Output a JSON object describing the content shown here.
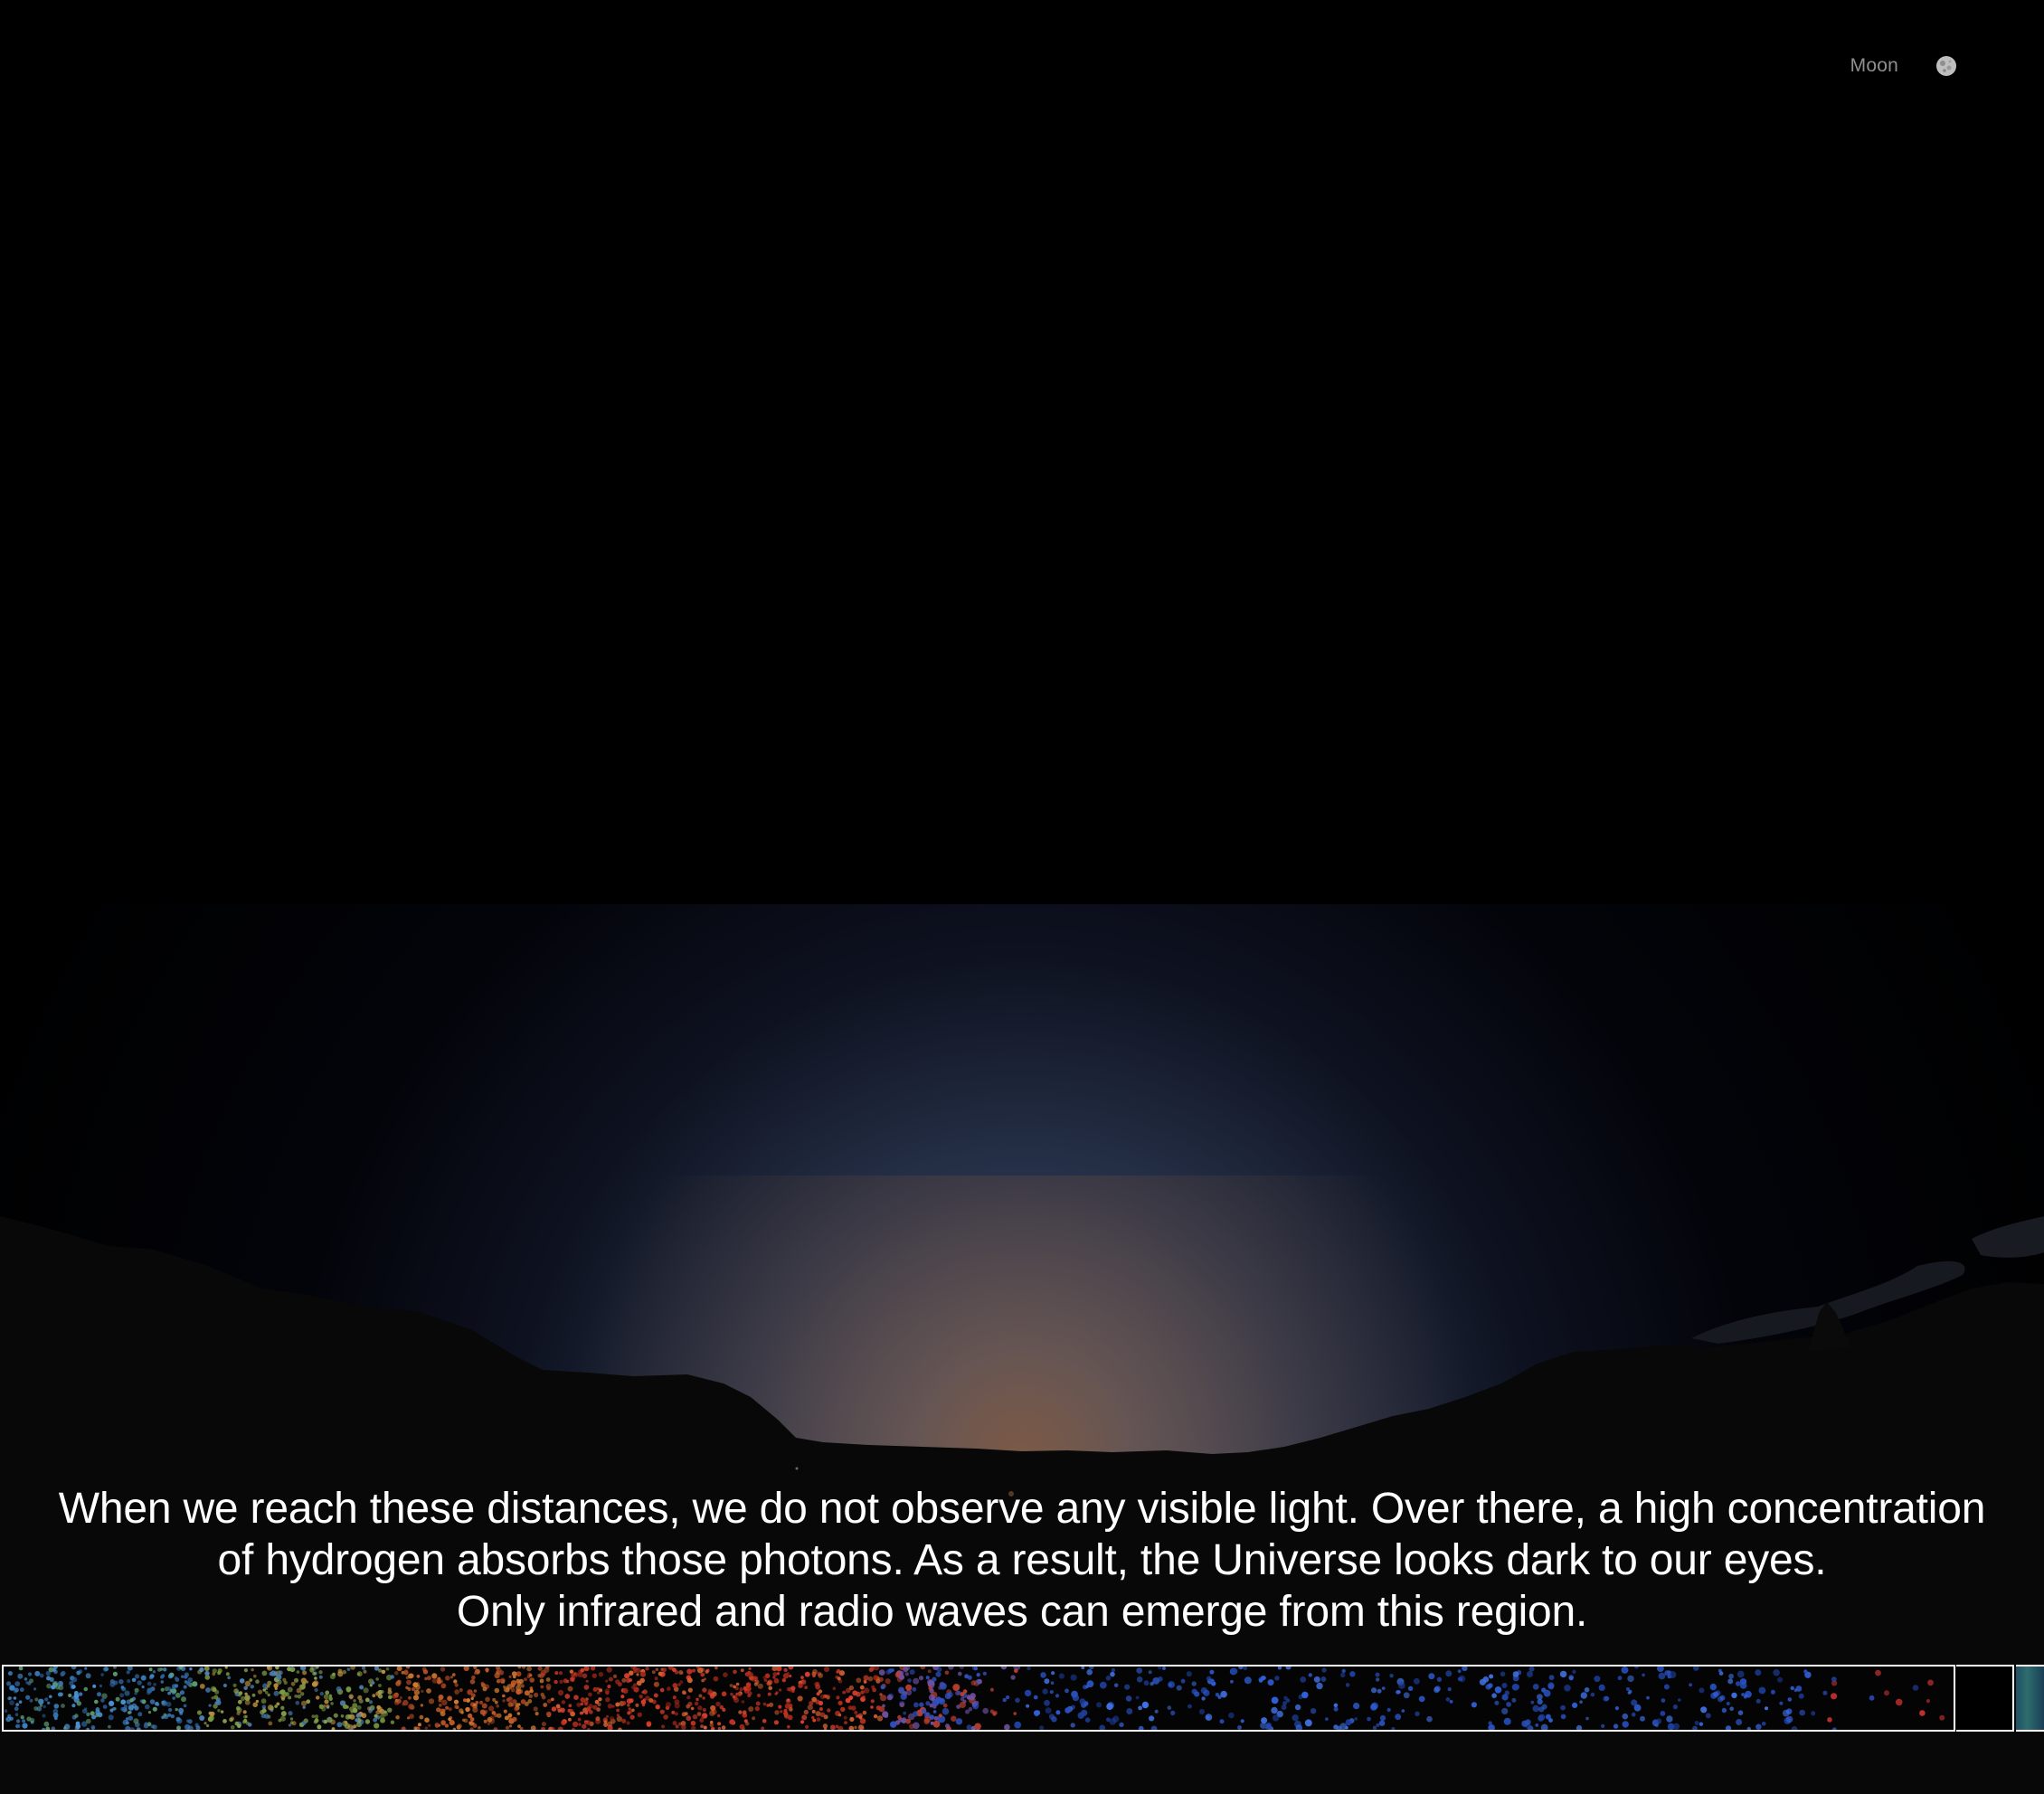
{
  "nav": {
    "moon_label": "Moon",
    "moon_icon": "moon-icon"
  },
  "caption": {
    "lines": [
      "When we reach these distances, we do not observe any visible light. Over there, a high concentration",
      "of hydrogen absorbs those photons. As a result, the Universe looks dark to our eyes.",
      "Only infrared and radio waves can emerge from this region."
    ]
  },
  "colors": {
    "background": "#000000",
    "caption_text": "#ffffff",
    "nav_text": "#8f8f8f",
    "horizon_glow": "#3a4a63",
    "sunset_tint": "#5a3a2a",
    "strip_border": "#ffffff"
  },
  "timeline": {
    "icon": "galaxy-survey-strip"
  }
}
